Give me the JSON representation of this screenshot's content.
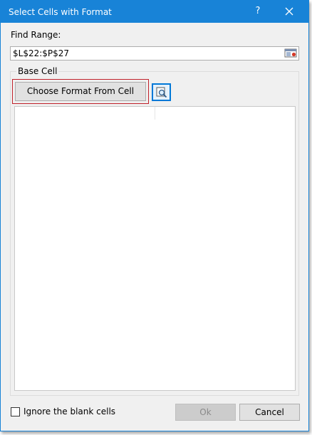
{
  "window": {
    "title": "Select Cells with Format",
    "help_label": "?"
  },
  "find_range": {
    "label": "Find Range:",
    "value": "$L$22:$P$27"
  },
  "base_cell": {
    "group_label": "Base Cell",
    "choose_button_label": "Choose Format From Cell"
  },
  "options": {
    "ignore_blank_label": "Ignore the blank cells",
    "ignore_blank_checked": false
  },
  "buttons": {
    "ok_label": "Ok",
    "ok_enabled": false,
    "cancel_label": "Cancel"
  },
  "colors": {
    "titlebar": "#1883d7",
    "highlight_border": "#c0202a",
    "focus_border": "#0078d7"
  }
}
